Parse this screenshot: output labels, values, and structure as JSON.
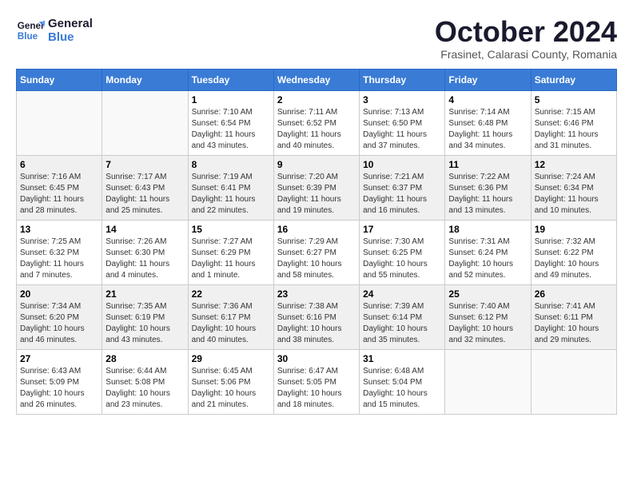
{
  "logo": {
    "line1": "General",
    "line2": "Blue"
  },
  "title": "October 2024",
  "location": "Frasinet, Calarasi County, Romania",
  "days_of_week": [
    "Sunday",
    "Monday",
    "Tuesday",
    "Wednesday",
    "Thursday",
    "Friday",
    "Saturday"
  ],
  "weeks": [
    [
      {
        "day": "",
        "info": ""
      },
      {
        "day": "",
        "info": ""
      },
      {
        "day": "1",
        "info": "Sunrise: 7:10 AM\nSunset: 6:54 PM\nDaylight: 11 hours and 43 minutes."
      },
      {
        "day": "2",
        "info": "Sunrise: 7:11 AM\nSunset: 6:52 PM\nDaylight: 11 hours and 40 minutes."
      },
      {
        "day": "3",
        "info": "Sunrise: 7:13 AM\nSunset: 6:50 PM\nDaylight: 11 hours and 37 minutes."
      },
      {
        "day": "4",
        "info": "Sunrise: 7:14 AM\nSunset: 6:48 PM\nDaylight: 11 hours and 34 minutes."
      },
      {
        "day": "5",
        "info": "Sunrise: 7:15 AM\nSunset: 6:46 PM\nDaylight: 11 hours and 31 minutes."
      }
    ],
    [
      {
        "day": "6",
        "info": "Sunrise: 7:16 AM\nSunset: 6:45 PM\nDaylight: 11 hours and 28 minutes."
      },
      {
        "day": "7",
        "info": "Sunrise: 7:17 AM\nSunset: 6:43 PM\nDaylight: 11 hours and 25 minutes."
      },
      {
        "day": "8",
        "info": "Sunrise: 7:19 AM\nSunset: 6:41 PM\nDaylight: 11 hours and 22 minutes."
      },
      {
        "day": "9",
        "info": "Sunrise: 7:20 AM\nSunset: 6:39 PM\nDaylight: 11 hours and 19 minutes."
      },
      {
        "day": "10",
        "info": "Sunrise: 7:21 AM\nSunset: 6:37 PM\nDaylight: 11 hours and 16 minutes."
      },
      {
        "day": "11",
        "info": "Sunrise: 7:22 AM\nSunset: 6:36 PM\nDaylight: 11 hours and 13 minutes."
      },
      {
        "day": "12",
        "info": "Sunrise: 7:24 AM\nSunset: 6:34 PM\nDaylight: 11 hours and 10 minutes."
      }
    ],
    [
      {
        "day": "13",
        "info": "Sunrise: 7:25 AM\nSunset: 6:32 PM\nDaylight: 11 hours and 7 minutes."
      },
      {
        "day": "14",
        "info": "Sunrise: 7:26 AM\nSunset: 6:30 PM\nDaylight: 11 hours and 4 minutes."
      },
      {
        "day": "15",
        "info": "Sunrise: 7:27 AM\nSunset: 6:29 PM\nDaylight: 11 hours and 1 minute."
      },
      {
        "day": "16",
        "info": "Sunrise: 7:29 AM\nSunset: 6:27 PM\nDaylight: 10 hours and 58 minutes."
      },
      {
        "day": "17",
        "info": "Sunrise: 7:30 AM\nSunset: 6:25 PM\nDaylight: 10 hours and 55 minutes."
      },
      {
        "day": "18",
        "info": "Sunrise: 7:31 AM\nSunset: 6:24 PM\nDaylight: 10 hours and 52 minutes."
      },
      {
        "day": "19",
        "info": "Sunrise: 7:32 AM\nSunset: 6:22 PM\nDaylight: 10 hours and 49 minutes."
      }
    ],
    [
      {
        "day": "20",
        "info": "Sunrise: 7:34 AM\nSunset: 6:20 PM\nDaylight: 10 hours and 46 minutes."
      },
      {
        "day": "21",
        "info": "Sunrise: 7:35 AM\nSunset: 6:19 PM\nDaylight: 10 hours and 43 minutes."
      },
      {
        "day": "22",
        "info": "Sunrise: 7:36 AM\nSunset: 6:17 PM\nDaylight: 10 hours and 40 minutes."
      },
      {
        "day": "23",
        "info": "Sunrise: 7:38 AM\nSunset: 6:16 PM\nDaylight: 10 hours and 38 minutes."
      },
      {
        "day": "24",
        "info": "Sunrise: 7:39 AM\nSunset: 6:14 PM\nDaylight: 10 hours and 35 minutes."
      },
      {
        "day": "25",
        "info": "Sunrise: 7:40 AM\nSunset: 6:12 PM\nDaylight: 10 hours and 32 minutes."
      },
      {
        "day": "26",
        "info": "Sunrise: 7:41 AM\nSunset: 6:11 PM\nDaylight: 10 hours and 29 minutes."
      }
    ],
    [
      {
        "day": "27",
        "info": "Sunrise: 6:43 AM\nSunset: 5:09 PM\nDaylight: 10 hours and 26 minutes."
      },
      {
        "day": "28",
        "info": "Sunrise: 6:44 AM\nSunset: 5:08 PM\nDaylight: 10 hours and 23 minutes."
      },
      {
        "day": "29",
        "info": "Sunrise: 6:45 AM\nSunset: 5:06 PM\nDaylight: 10 hours and 21 minutes."
      },
      {
        "day": "30",
        "info": "Sunrise: 6:47 AM\nSunset: 5:05 PM\nDaylight: 10 hours and 18 minutes."
      },
      {
        "day": "31",
        "info": "Sunrise: 6:48 AM\nSunset: 5:04 PM\nDaylight: 10 hours and 15 minutes."
      },
      {
        "day": "",
        "info": ""
      },
      {
        "day": "",
        "info": ""
      }
    ]
  ]
}
